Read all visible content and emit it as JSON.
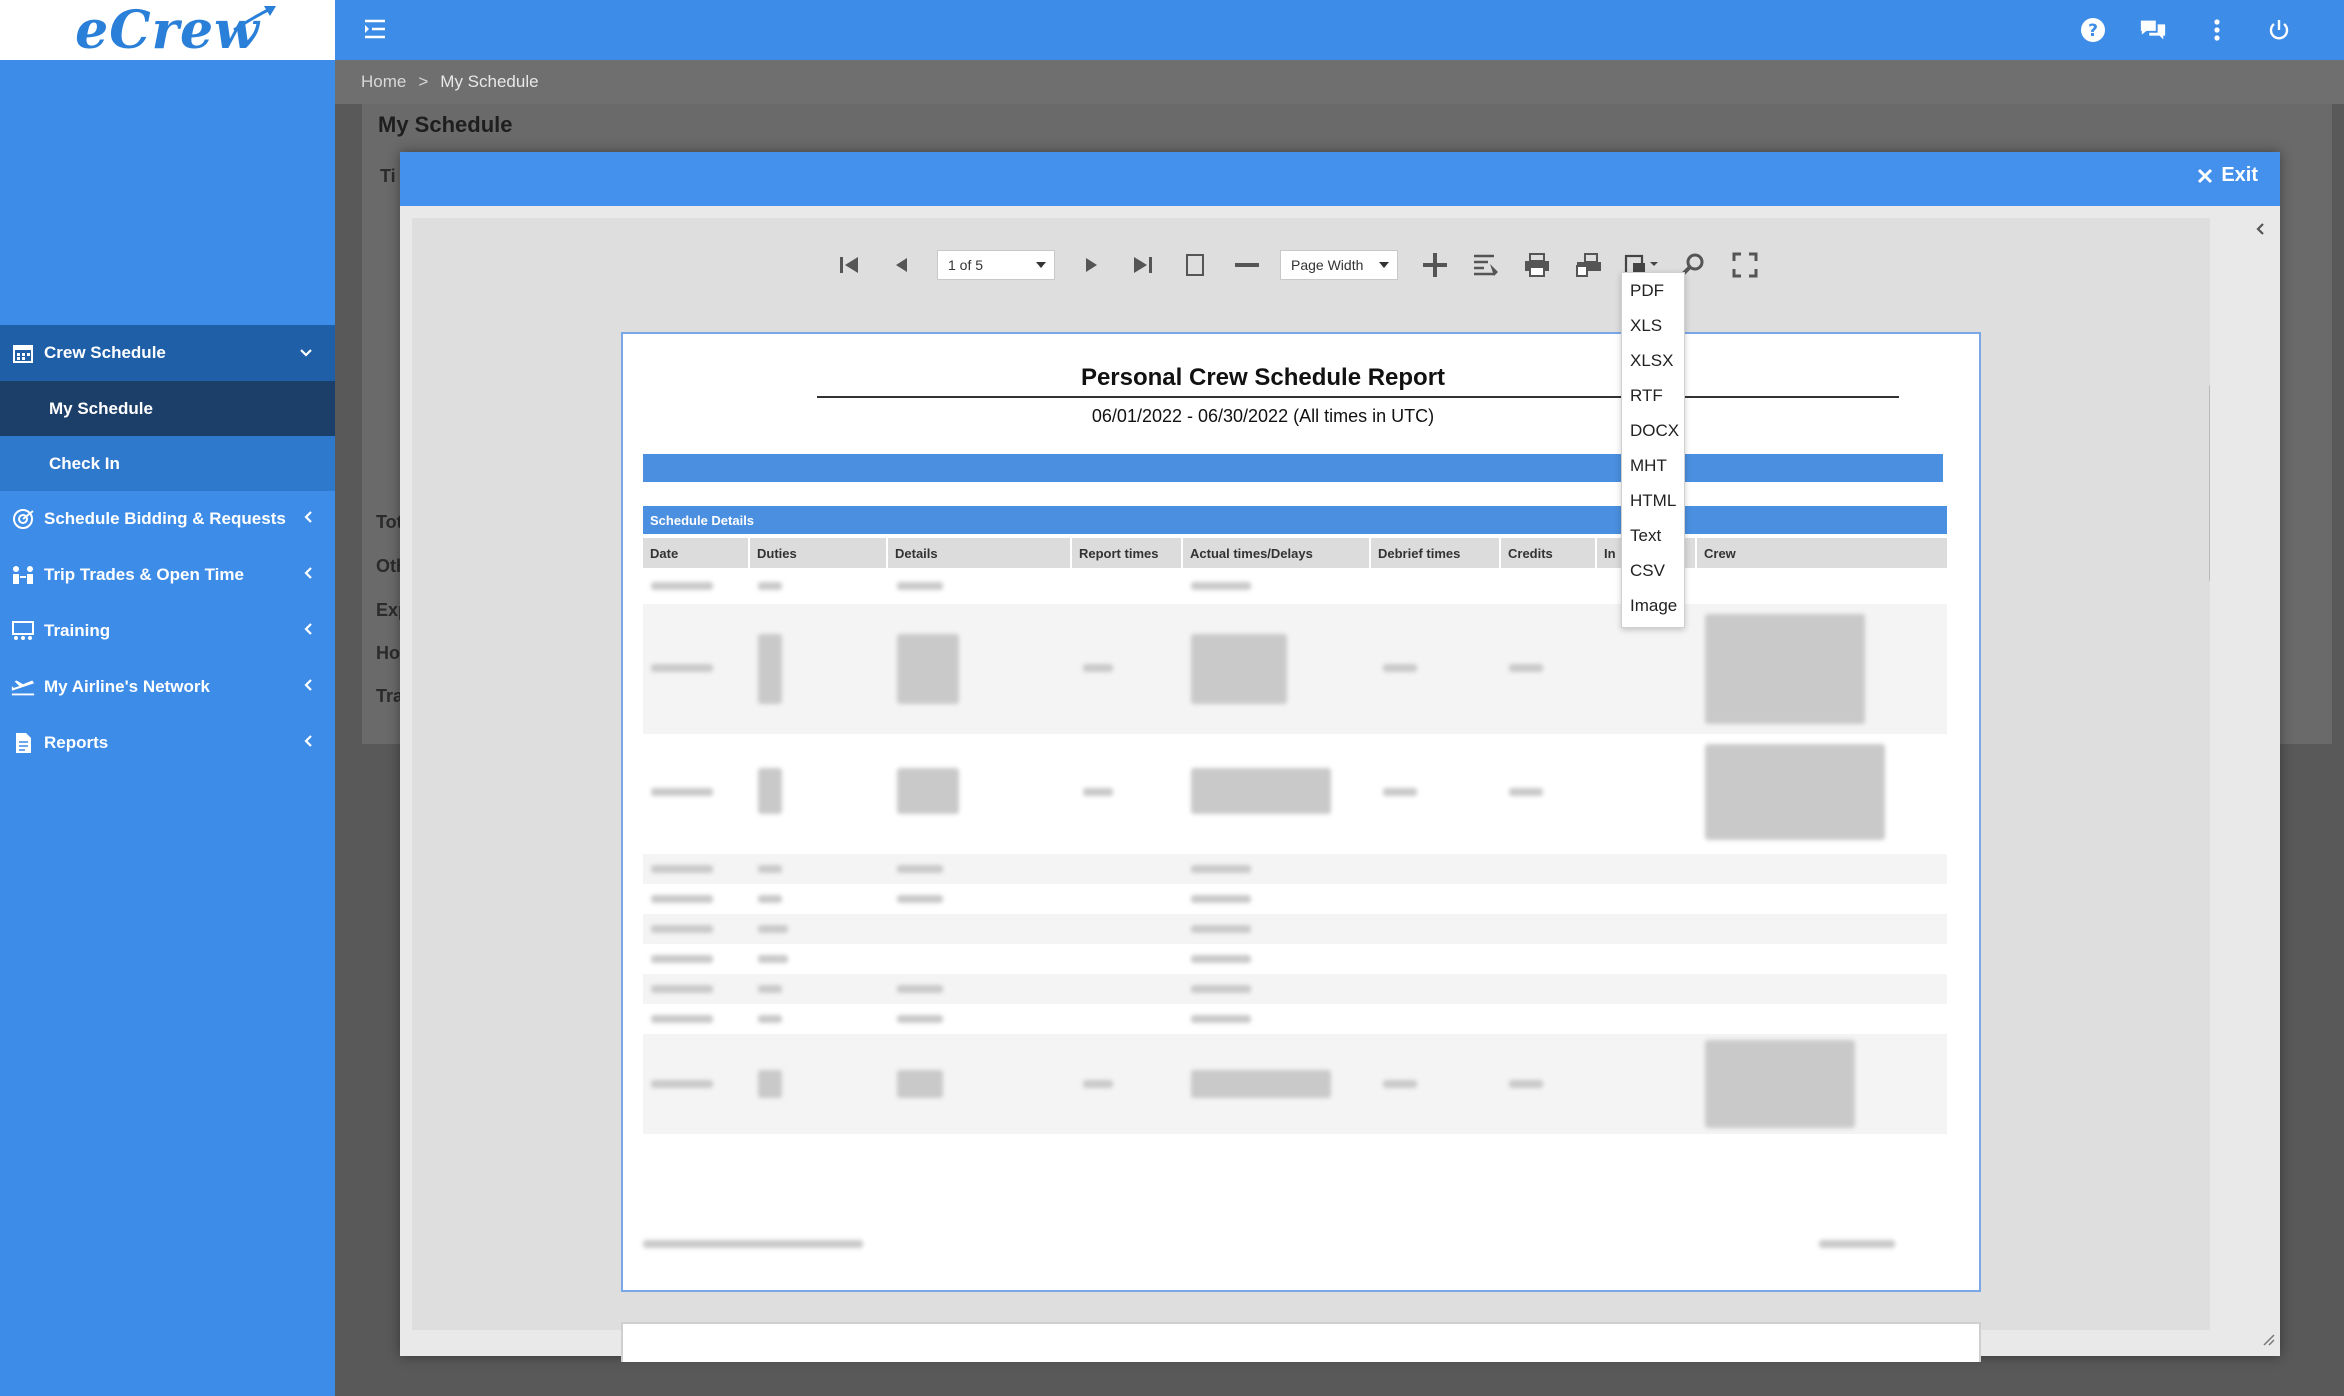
{
  "app": {
    "logo": "eCrew"
  },
  "sidebar": {
    "items": [
      {
        "label": "Crew Schedule",
        "expanded": true,
        "children": [
          {
            "label": "My Schedule"
          },
          {
            "label": "Check In"
          }
        ]
      },
      {
        "label": "Schedule Bidding & Requests"
      },
      {
        "label": "Trip Trades & Open Time"
      },
      {
        "label": "Training"
      },
      {
        "label": "My Airline's Network"
      },
      {
        "label": "Reports"
      }
    ]
  },
  "breadcrumb": {
    "home": "Home",
    "separator": ">",
    "current": "My Schedule"
  },
  "page": {
    "title": "My Schedule",
    "tabs_partial": [
      "Ti",
      "Tot",
      "Oth",
      "Exp",
      "Ho",
      "Tra"
    ]
  },
  "modal": {
    "exit_label": "Exit",
    "toolbar": {
      "page_select": "1 of 5",
      "zoom_select": "Page Width"
    },
    "export_menu": [
      "PDF",
      "XLS",
      "XLSX",
      "RTF",
      "DOCX",
      "MHT",
      "HTML",
      "Text",
      "CSV",
      "Image"
    ]
  },
  "report": {
    "title": "Personal Crew Schedule Report",
    "subtitle": "06/01/2022 - 06/30/2022 (All times in UTC)",
    "section": "Schedule Details",
    "columns": [
      "Date",
      "Duties",
      "Details",
      "Report times",
      "Actual times/Delays",
      "Debrief times",
      "Credits",
      "In",
      "Crew"
    ]
  },
  "colors": {
    "accent": "#3d8ce8",
    "sidebar_active": "#1c3f6a",
    "report_band": "#4a8fe0"
  }
}
